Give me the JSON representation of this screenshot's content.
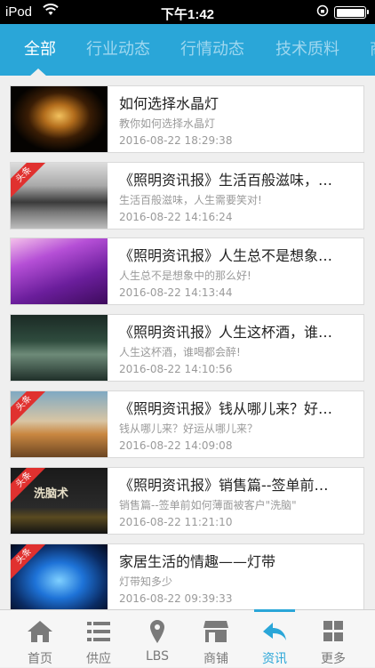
{
  "status_bar": {
    "carrier": "iPod",
    "time": "下午1:42"
  },
  "tabs": [
    {
      "label": "全部",
      "active": true
    },
    {
      "label": "行业动态",
      "active": false
    },
    {
      "label": "行情动态",
      "active": false
    },
    {
      "label": "技术质料",
      "active": false
    },
    {
      "label": "商",
      "active": false
    }
  ],
  "news": [
    {
      "title": "如何选择水晶灯",
      "subtitle": "教你如何选择水晶灯",
      "date": "2016-08-22 18:29:38",
      "badge": ""
    },
    {
      "title": "《照明资讯报》生活百般滋味，…",
      "subtitle": "生活百般滋味，人生需要笑对!",
      "date": "2016-08-22 14:16:24",
      "badge": "头条"
    },
    {
      "title": "《照明资讯报》人生总不是想象…",
      "subtitle": "人生总不是想象中的那么好!",
      "date": "2016-08-22 14:13:44",
      "badge": ""
    },
    {
      "title": "《照明资讯报》人生这杯酒，谁…",
      "subtitle": "人生这杯酒，谁喝都会醉!",
      "date": "2016-08-22 14:10:56",
      "badge": ""
    },
    {
      "title": "《照明资讯报》钱从哪儿来？好…",
      "subtitle": "钱从哪儿来？好运从哪儿来？",
      "date": "2016-08-22 14:09:08",
      "badge": "头条"
    },
    {
      "title": "《照明资讯报》销售篇--签单前…",
      "subtitle": "销售篇--签单前如何薄面被客户\"洗脑\"",
      "date": "2016-08-22 11:21:10",
      "badge": "头条",
      "thumb_text": "洗脑术"
    },
    {
      "title": "家居生活的情趣——灯带",
      "subtitle": "灯带知多少",
      "date": "2016-08-22 09:39:33",
      "badge": "头条"
    }
  ],
  "bottom_nav": [
    {
      "label": "首页",
      "icon": "home-icon",
      "active": false
    },
    {
      "label": "供应",
      "icon": "list-icon",
      "active": false
    },
    {
      "label": "LBS",
      "icon": "location-pin-icon",
      "active": false
    },
    {
      "label": "商铺",
      "icon": "shop-icon",
      "active": false
    },
    {
      "label": "资讯",
      "icon": "news-icon",
      "active": true
    },
    {
      "label": "更多",
      "icon": "grid-icon",
      "active": false
    }
  ],
  "colors": {
    "accent": "#2aa6d8",
    "badge": "#e0312f"
  }
}
